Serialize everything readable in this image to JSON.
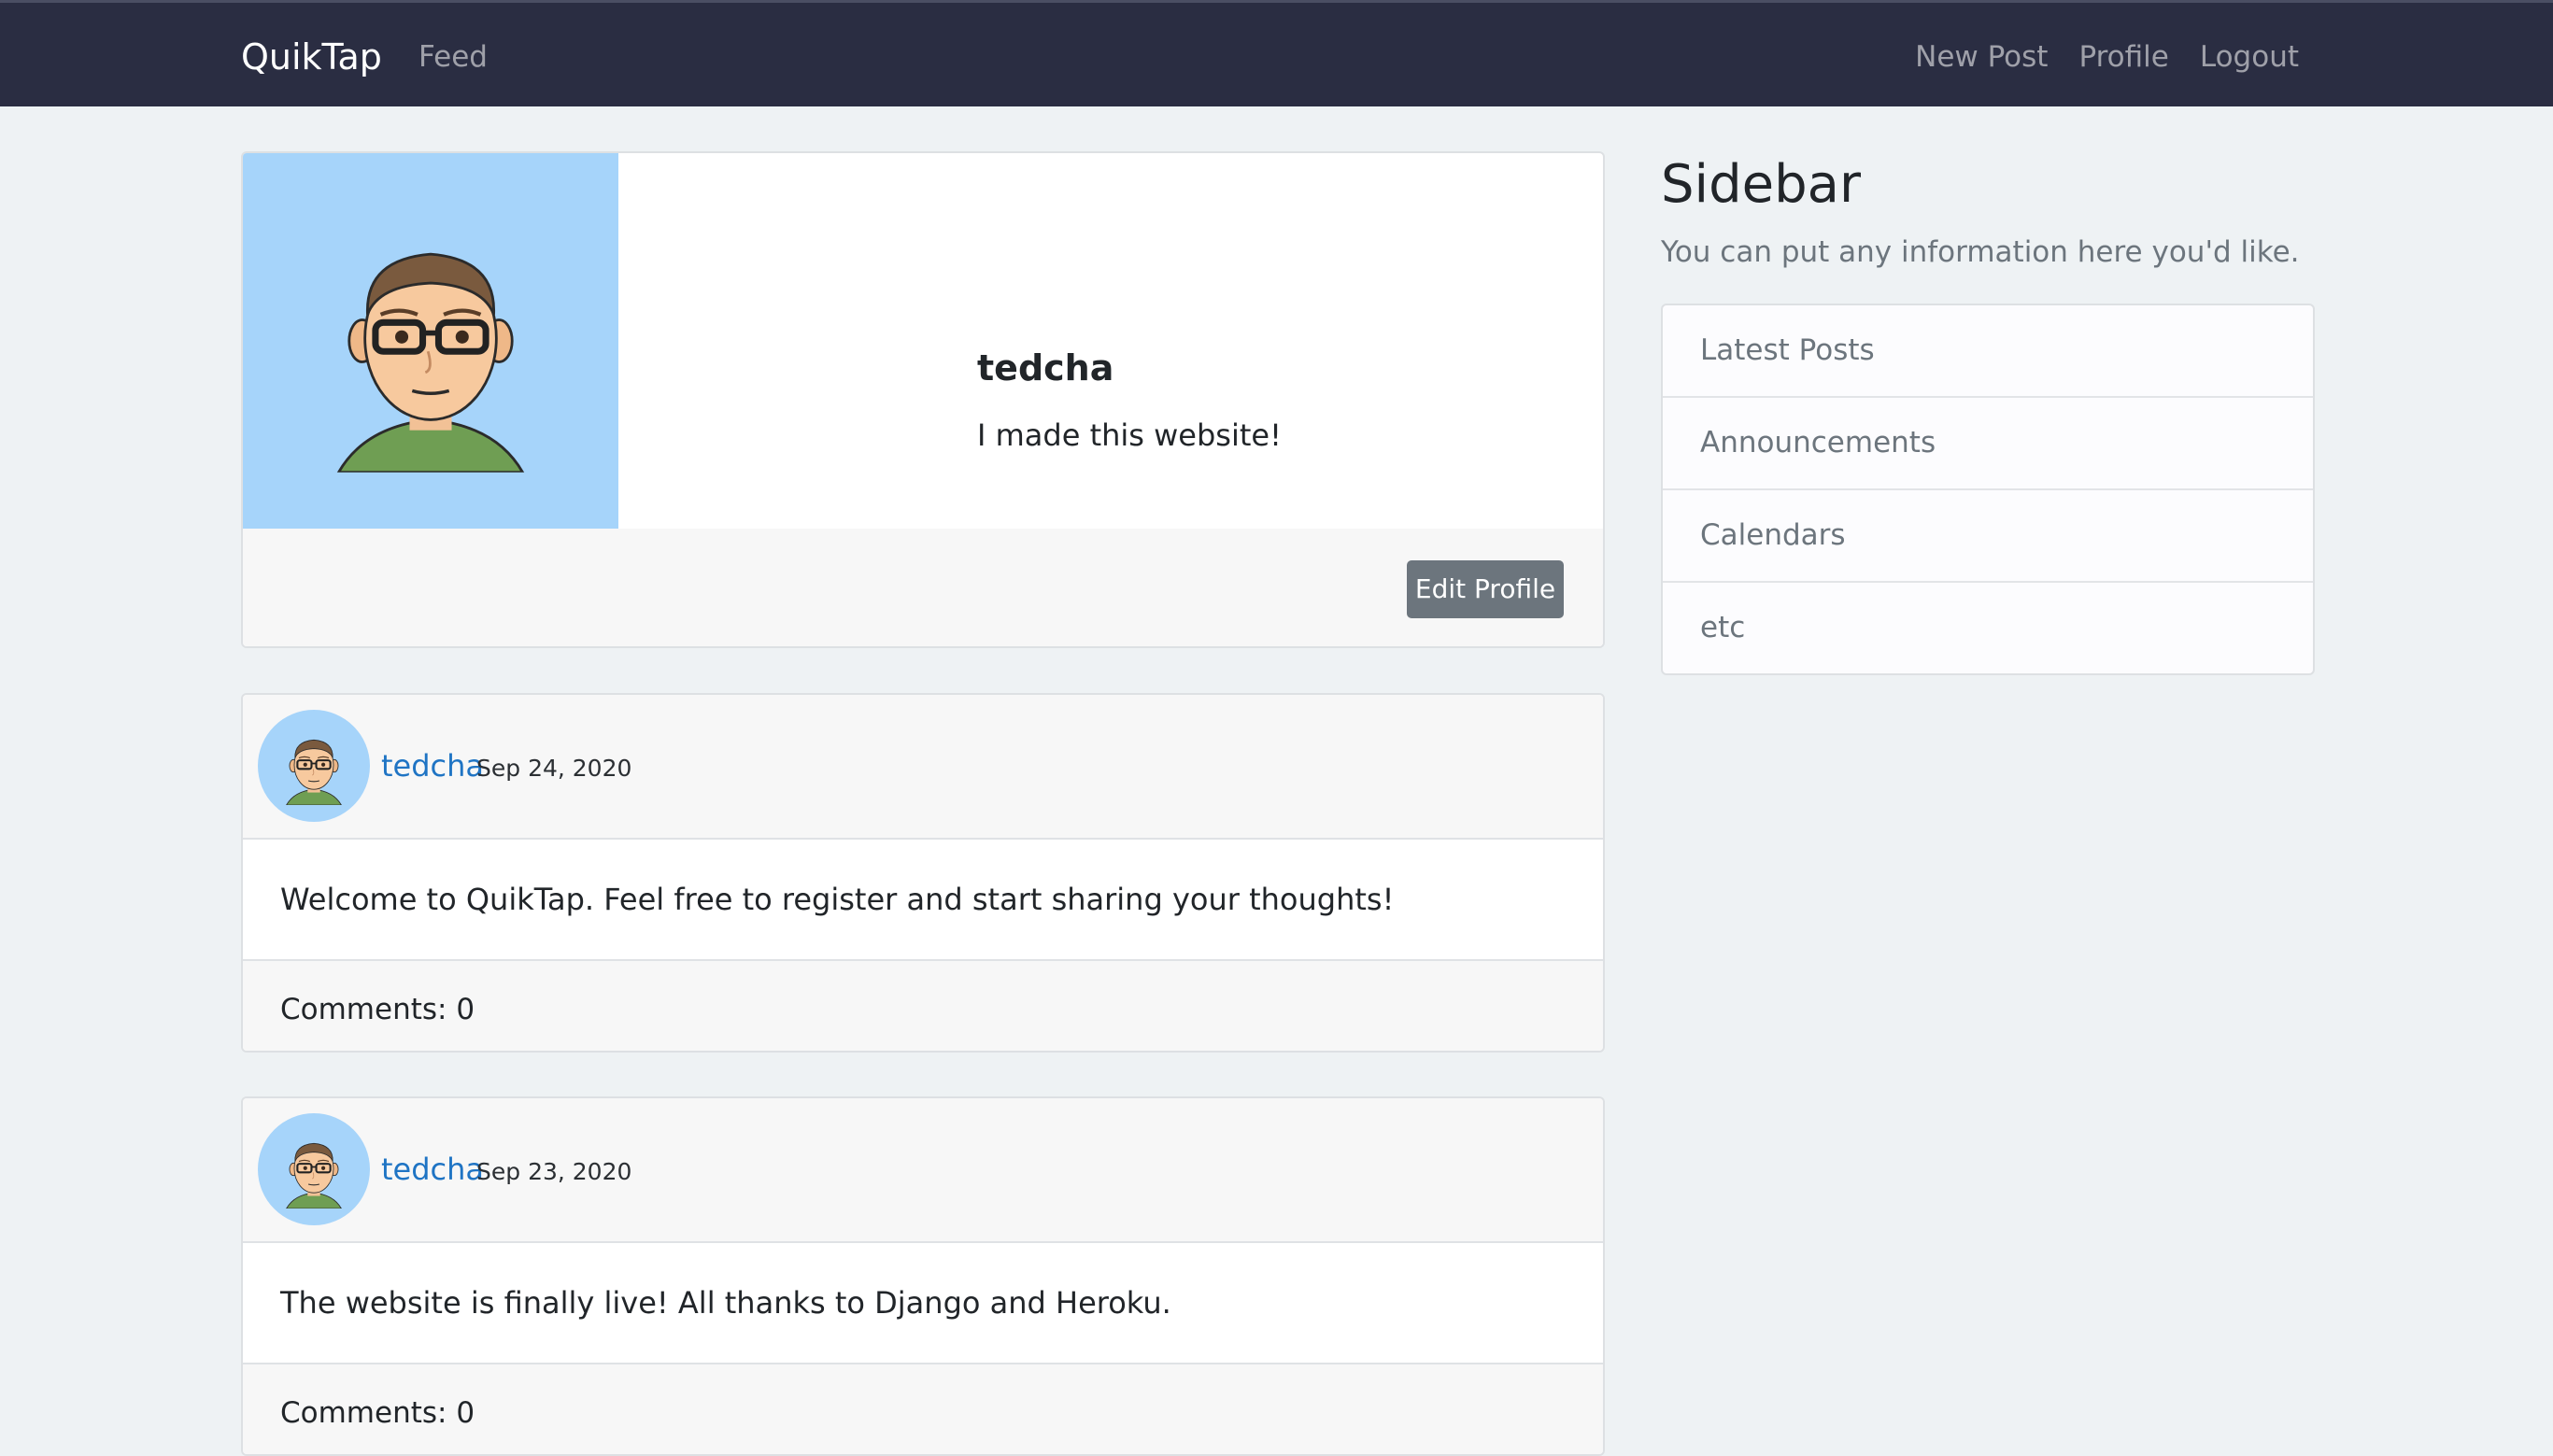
{
  "nav": {
    "brand": "QuikTap",
    "feed": "Feed",
    "new_post": "New Post",
    "profile": "Profile",
    "logout": "Logout"
  },
  "profile": {
    "username": "tedcha",
    "bio": "I made this website!",
    "edit_button": "Edit Profile"
  },
  "posts": [
    {
      "author": "tedcha",
      "date": "Sep 24, 2020",
      "content": "Welcome to QuikTap. Feel free to register and start sharing your thoughts!",
      "comments": "Comments: 0"
    },
    {
      "author": "tedcha",
      "date": "Sep 23, 2020",
      "content": "The website is finally live! All thanks to Django and Heroku.",
      "comments": "Comments: 0"
    }
  ],
  "sidebar": {
    "title": "Sidebar",
    "subtitle": "You can put any information here you'd like.",
    "items": [
      "Latest Posts",
      "Announcements",
      "Calendars",
      "etc"
    ]
  },
  "colors": {
    "navbar": "#2a2d42",
    "page_bg": "#eef2f4",
    "link": "#1f74c4",
    "avatar_bg": "#a6d4fa",
    "button": "#6c757d"
  }
}
